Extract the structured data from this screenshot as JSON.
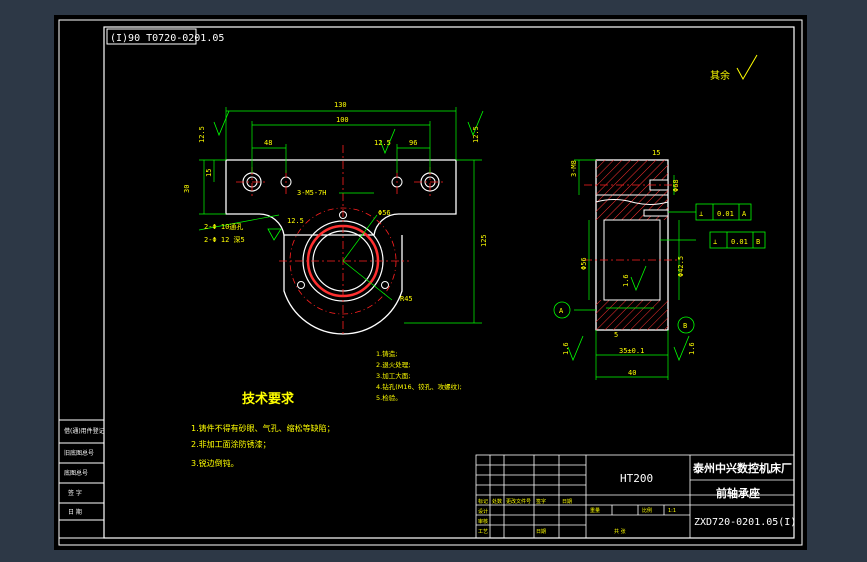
{
  "drawing": {
    "header_code": "(I)90 T0720-0201.05",
    "roughness_note": "其余",
    "section_title": "技术要求",
    "notes": [
      "1.铸件不得有砂眼、气孔、缩松等缺陷；",
      "2.非加工面涂防锈漆；",
      "3.锐边倒钝。"
    ],
    "feature_notes": [
      "1.铸造;",
      "2.退火处理;",
      "3.加工大面;",
      "4.钻孔(M16、铰孔、攻螺纹);",
      "5.检验。"
    ],
    "dims": {
      "overall_width": "130",
      "hole_spacing": "100",
      "left_offset": "48",
      "right_offset": "96",
      "thickness": "12.5",
      "left_chamfer": "12.5",
      "roughness_right": "12.5",
      "height_small": "30",
      "depth_small": "15",
      "thread_label": "3-M5-7H",
      "dia_seat": "Φ56",
      "radius": "R45",
      "roughness_mid": "12.5",
      "overall_height": "125",
      "hole_note_1": "2-Φ 10通孔",
      "hole_note_2": "2-Φ 12 深5",
      "side_thread": "3-M8",
      "side_depth": "15",
      "side_dia": "Φ68",
      "side_bore": "Φ56",
      "side_bore_2": "Φ42.5",
      "side_width": "35±0.1",
      "side_total": "40",
      "side_ra_left": "1.6",
      "side_ra_mid": "1.6",
      "side_ra_right": "1.6",
      "side_small": "5",
      "tol_1_sym": "⊥",
      "tol_1_val": "0.01",
      "tol_1_ref": "A",
      "tol_2_sym": "⊥",
      "tol_2_val": "0.01",
      "tol_2_ref": "B",
      "datum_a": "A",
      "datum_b": "B"
    },
    "title_block": {
      "material": "HT200",
      "company": "泰州中兴数控机床厂",
      "part_name": "前轴承座",
      "drawing_no": "ZXD720-0201.05(I)",
      "scale_label": "比例",
      "scale": "1:1",
      "weight_label": "重量",
      "sheet_label": "共  张",
      "date_label": "日期",
      "mark_labels": [
        "标记",
        "处数",
        "更改文件号",
        "签字",
        "日期"
      ],
      "role_labels": [
        "设计",
        "审核",
        "工艺",
        "批准"
      ]
    },
    "left_strip": [
      "借(通)用件登记",
      "旧底图总号",
      "底图总号",
      "签  字",
      "日  期"
    ],
    "colors": {
      "background": "#2d3846",
      "sheet": "#000000",
      "frame": "#ffffff",
      "geometry": "#ffffff",
      "centerline": "#ff2020",
      "dimension": "#00ff00",
      "text": "#ffff00",
      "hatch": "#ff3030",
      "cyan": "#00ffff"
    }
  }
}
